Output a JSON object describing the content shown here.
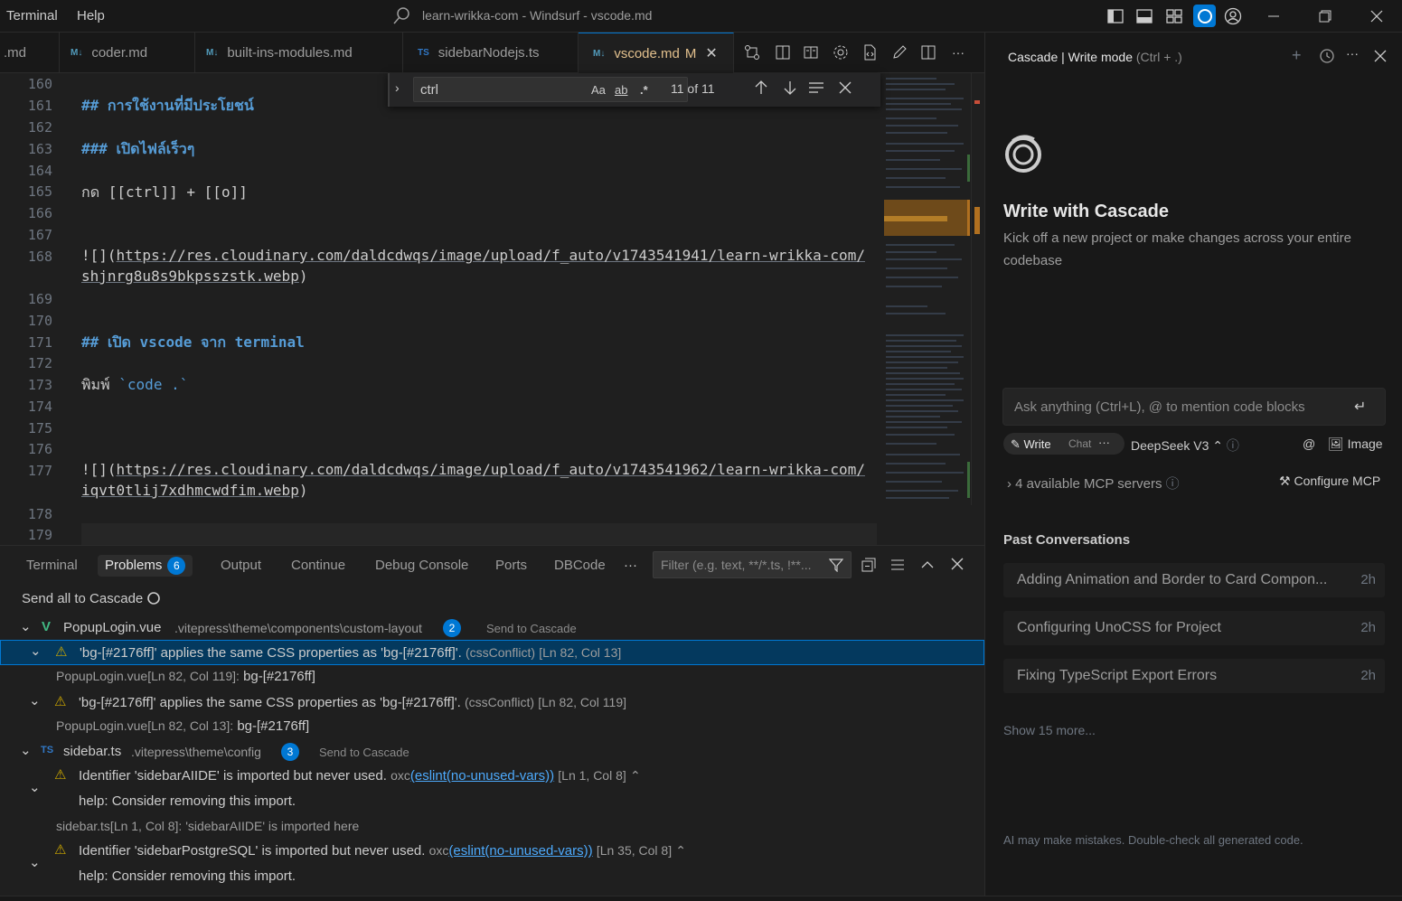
{
  "titlebar": {
    "menu": [
      "Terminal",
      "Help"
    ],
    "title": "learn-wrikka-com - Windsurf - vscode.md"
  },
  "tabs": [
    {
      "label": ".md",
      "icon": ""
    },
    {
      "label": "coder.md",
      "icon": "M↓"
    },
    {
      "label": "built-ins-modules.md",
      "icon": "M↓"
    },
    {
      "label": "sidebarNodejs.ts",
      "icon": "TS"
    },
    {
      "label": "vscode.md",
      "icon": "M↓",
      "modified": "M",
      "active": true
    }
  ],
  "find": {
    "value": "ctrl",
    "match_case": "Aa",
    "whole_word": "ab",
    "regex": ".*",
    "count": "11 of 11"
  },
  "editor": {
    "line_numbers": [
      "160",
      "161",
      "162",
      "163",
      "164",
      "165",
      "166",
      "167",
      "168",
      "169",
      "170",
      "171",
      "172",
      "173",
      "174",
      "175",
      "176",
      "177",
      "178",
      "179"
    ],
    "lines": {
      "l161": "## การใช้งานที่มีประโยชน์",
      "l163": "### เปิดไฟล์เร็วๆ",
      "l165": "กด [[ctrl]] + [[o]]",
      "l168a_prefix": "![](",
      "l168a_url": "https://res.cloudinary.com/daldcdwqs/image/upload/f_auto/v1743541941/learn-wrikka-com/",
      "l168b_url": "shjnrg8u8s9bkpsszstk.webp",
      "l168b_suffix": ")",
      "l171": "## เปิด vscode จาก terminal",
      "l173_text": "พิมพ์ ",
      "l173_code": "`code .`",
      "l177a_prefix": "![](",
      "l177a_url": "https://res.cloudinary.com/daldcdwqs/image/upload/f_auto/v1743541962/learn-wrikka-com/",
      "l177b_url": "iqvt0tlij7xdhmcwdfim.webp",
      "l177b_suffix": ")"
    }
  },
  "panel": {
    "tabs": [
      "Terminal",
      "Problems",
      "Output",
      "Continue",
      "Debug Console",
      "Ports",
      "DBCode"
    ],
    "problems_count": "6",
    "more": "···",
    "filter_placeholder": "Filter (e.g. text, **/*.ts, !**...",
    "send_all": "Send all to Cascade",
    "groups": [
      {
        "file": "PopupLogin.vue",
        "path": ".vitepress\\theme\\components\\custom-layout",
        "count": "2",
        "send": "Send to Cascade"
      },
      {
        "file": "sidebar.ts",
        "path": ".vitepress\\theme\\config",
        "count": "3",
        "send": "Send to Cascade"
      }
    ],
    "items": {
      "p1_msg": "'bg-[#2176ff]' applies the same CSS properties as 'bg-[#2176ff]'.",
      "p1_code": "(cssConflict)",
      "p1_loc": "[Ln 82, Col 13]",
      "p1_rel_loc": "PopupLogin.vue[Ln 82, Col 119]:",
      "p1_rel_val": "bg-[#2176ff]",
      "p2_msg": "'bg-[#2176ff]' applies the same CSS properties as 'bg-[#2176ff]'.",
      "p2_code": "(cssConflict)",
      "p2_loc": "[Ln 82, Col 119]",
      "p2_rel_loc": "PopupLogin.vue[Ln 82, Col 13]:",
      "p2_rel_val": "bg-[#2176ff]",
      "p3_msg": "Identifier 'sidebarAIIDE' is imported but never used.",
      "p3_src": "oxc",
      "p3_link": "(eslint(no-unused-vars))",
      "p3_loc": "[Ln 1, Col 8]",
      "p3_help": "help: Consider removing this import.",
      "p3_rel": "sidebar.ts[Ln 1, Col 8]: 'sidebarAIIDE' is imported here",
      "p4_msg": "Identifier 'sidebarPostgreSQL' is imported but never used.",
      "p4_src": "oxc",
      "p4_link": "(eslint(no-unused-vars))",
      "p4_loc": "[Ln 35, Col 8]",
      "p4_help": "help: Consider removing this import."
    }
  },
  "cascade": {
    "header_title": "Cascade | Write mode",
    "header_shortcut": "(Ctrl + .)",
    "heading": "Write with Cascade",
    "subtitle_1": "Kick off a new project or make changes across your entire",
    "subtitle_2": "codebase",
    "ask_placeholder": "Ask anything (Ctrl+L), @ to mention code blocks",
    "mode_write": "Write",
    "mode_chat": "Chat",
    "mode_more": "···",
    "model": "DeepSeek V3",
    "image_label": "Image",
    "mcp_servers": "4 available MCP servers",
    "configure_mcp": "Configure MCP",
    "past_title": "Past Conversations",
    "past": [
      {
        "title": "Adding Animation and Border to Card Compon...",
        "ago": "2h"
      },
      {
        "title": "Configuring UnoCSS for Project",
        "ago": "2h"
      },
      {
        "title": "Fixing TypeScript Export Errors",
        "ago": "2h"
      }
    ],
    "show_more": "Show 15 more...",
    "disclaimer": "AI may make mistakes. Double-check all generated code."
  },
  "colors": {
    "accent": "#0078d4",
    "heading_blue": "#569cd6",
    "warning": "#cca700",
    "modified": "#e2c08d",
    "link": "#4daafc"
  }
}
